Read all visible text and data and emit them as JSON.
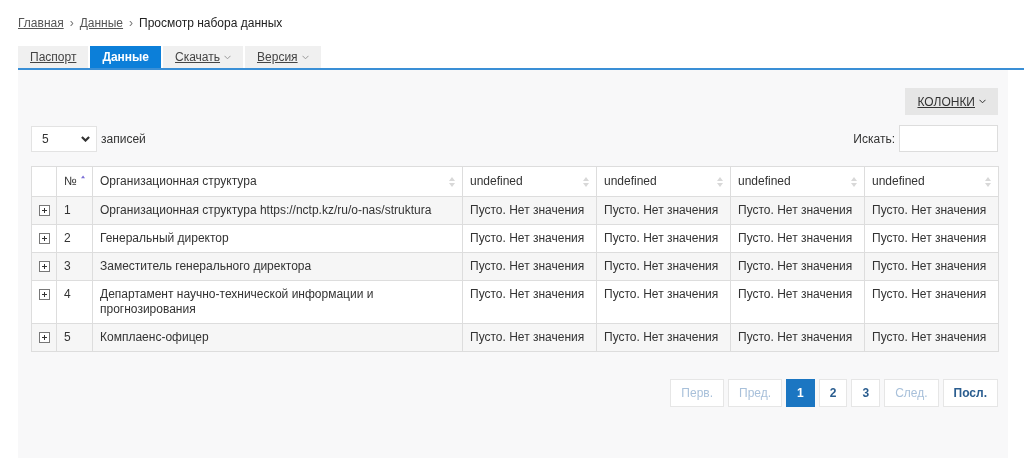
{
  "breadcrumbs": [
    {
      "label": "Главная",
      "link": true
    },
    {
      "label": "Данные",
      "link": true,
      "separator": "›"
    },
    {
      "label": "Просмотр набора данных",
      "link": false,
      "separator": "›"
    }
  ],
  "tabs": [
    {
      "label": "Паспорт",
      "selected": false,
      "dropdown": false
    },
    {
      "label": "Данные",
      "selected": true,
      "dropdown": false
    },
    {
      "label": "Скачать",
      "selected": false,
      "dropdown": true
    },
    {
      "label": "Версия",
      "selected": false,
      "dropdown": true
    }
  ],
  "columns_button": {
    "label": "КОЛОНКИ"
  },
  "page_size": {
    "value": "5",
    "label": "записей"
  },
  "search": {
    "label": "Искать:"
  },
  "table": {
    "columns": [
      {
        "label": "№",
        "sorted": true
      },
      {
        "label": "Организационная структура",
        "sorted": false
      },
      {
        "label": "undefined",
        "sorted": false
      },
      {
        "label": "undefined",
        "sorted": false
      },
      {
        "label": "undefined",
        "sorted": false
      },
      {
        "label": "undefined",
        "sorted": false
      }
    ],
    "rows": [
      {
        "expanded": false,
        "cells": [
          "1",
          "Организационная структура https://nctp.kz/ru/o-nas/struktura",
          "Пусто. Нет значения",
          "Пусто. Нет значения",
          "Пусто. Нет значения",
          "Пусто. Нет значения"
        ]
      },
      {
        "expanded": false,
        "cells": [
          "2",
          "Генеральный директор",
          "Пусто. Нет значения",
          "Пусто. Нет значения",
          "Пусто. Нет значения",
          "Пусто. Нет значения"
        ]
      },
      {
        "expanded": false,
        "cells": [
          "3",
          "Заместитель генерального директора",
          "Пусто. Нет значения",
          "Пусто. Нет значения",
          "Пусто. Нет значения",
          "Пусто. Нет значения"
        ]
      },
      {
        "expanded": false,
        "cells": [
          "4",
          "Департамент научно-технической информации и прогнозирования",
          "Пусто. Нет значения",
          "Пусто. Нет значения",
          "Пусто. Нет значения",
          "Пусто. Нет значения"
        ]
      },
      {
        "expanded": false,
        "cells": [
          "5",
          "Комплаенс-офицер",
          "Пусто. Нет значения",
          "Пусто. Нет значения",
          "Пусто. Нет значения",
          "Пусто. Нет значения"
        ]
      }
    ]
  },
  "pagination": [
    {
      "label": "Перв.",
      "disabled": true,
      "selected": false
    },
    {
      "label": "Пред.",
      "disabled": true,
      "selected": false
    },
    {
      "label": "1",
      "disabled": false,
      "selected": true
    },
    {
      "label": "2",
      "disabled": false,
      "selected": false
    },
    {
      "label": "3",
      "disabled": false,
      "selected": false
    },
    {
      "label": "След.",
      "disabled": true,
      "selected": false
    },
    {
      "label": "Посл.",
      "disabled": false,
      "selected": false
    }
  ]
}
